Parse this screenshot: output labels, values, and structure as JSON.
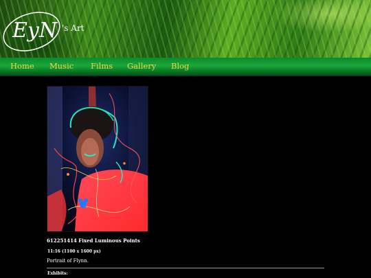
{
  "header": {
    "logo_text": "EyN",
    "logo_suffix": "'s Art"
  },
  "nav": {
    "items": [
      {
        "label": "Home"
      },
      {
        "label": "Music"
      },
      {
        "label": "Films"
      },
      {
        "label": "Gallery"
      },
      {
        "label": "Blog"
      }
    ],
    "link_color": "#f3d64a"
  },
  "artwork": {
    "title": "612251414 Fixed Luminous Points",
    "size": "11:16 (1100 x 1600 px)",
    "description": "Portrait of Flynn.",
    "palette": [
      "#ff3b3b",
      "#23e0b0",
      "#2f6fff",
      "#1a1a1a"
    ]
  },
  "exhibits_label": "Exhibits:"
}
